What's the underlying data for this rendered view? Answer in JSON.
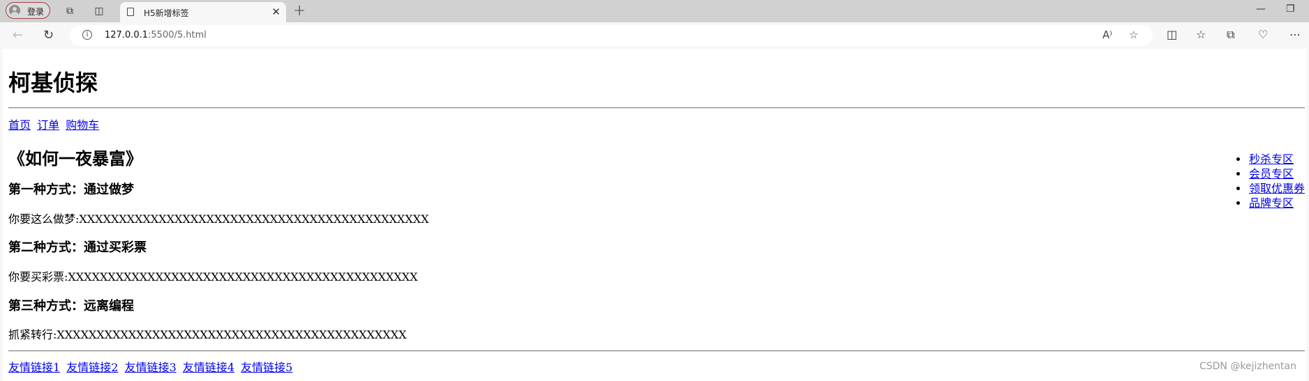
{
  "browser": {
    "profile_label": "登录",
    "tab_title": "H5新增标签",
    "url_host": "127.0.0.1",
    "url_rest": ":5500/5.html"
  },
  "page": {
    "site_title": "柯基侦探",
    "nav": [
      "首页",
      "订单",
      "购物车"
    ],
    "article_title": "《如何一夜暴富》",
    "sections": [
      {
        "heading": "第一种方式：通过做梦",
        "text": "你要这么做梦:XXXXXXXXXXXXXXXXXXXXXXXXXXXXXXXXXXXXXXXXXXXX"
      },
      {
        "heading": "第二种方式：通过买彩票",
        "text": "你要买彩票:XXXXXXXXXXXXXXXXXXXXXXXXXXXXXXXXXXXXXXXXXXXX"
      },
      {
        "heading": "第三种方式：远离编程",
        "text": "抓紧转行:XXXXXXXXXXXXXXXXXXXXXXXXXXXXXXXXXXXXXXXXXXXX"
      }
    ],
    "sidebar": [
      "秒杀专区",
      "会员专区",
      "领取优惠券",
      "品牌专区"
    ],
    "friend_links": [
      "友情链接1",
      "友情链接2",
      "友情链接3",
      "友情链接4",
      "友情链接5"
    ],
    "watermark": "CSDN @kejizhentan"
  }
}
